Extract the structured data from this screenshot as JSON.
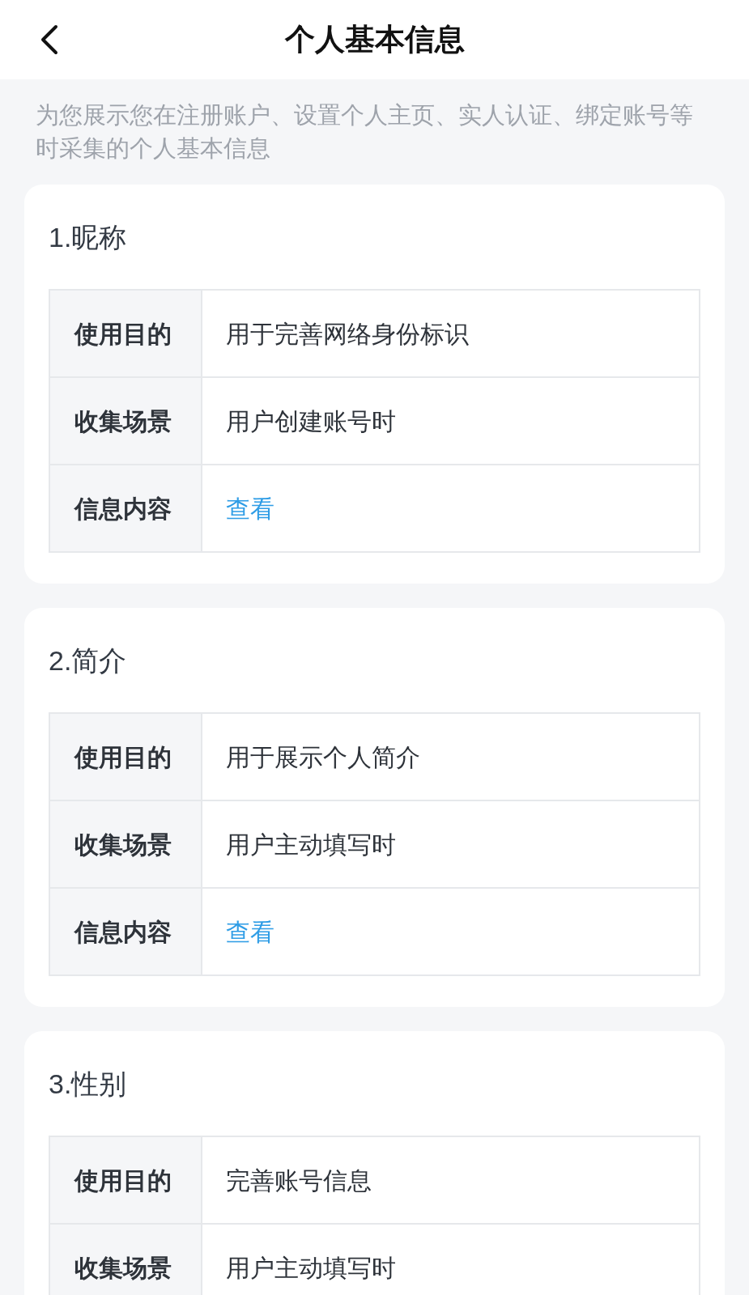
{
  "header": {
    "title": "个人基本信息"
  },
  "intro": "为您展示您在注册账户、设置个人主页、实人认证、绑定账号等时采集的个人基本信息",
  "sections": [
    {
      "title": "1.昵称",
      "rows": [
        {
          "label": "使用目的",
          "kind": "text",
          "value": "用于完善网络身份标识"
        },
        {
          "label": "收集场景",
          "kind": "text",
          "value": "用户创建账号时"
        },
        {
          "label": "信息内容",
          "kind": "link",
          "value": "查看"
        }
      ]
    },
    {
      "title": "2.简介",
      "rows": [
        {
          "label": "使用目的",
          "kind": "text",
          "value": "用于展示个人简介"
        },
        {
          "label": "收集场景",
          "kind": "text",
          "value": "用户主动填写时"
        },
        {
          "label": "信息内容",
          "kind": "link",
          "value": "查看"
        }
      ]
    },
    {
      "title": "3.性别",
      "rows": [
        {
          "label": "使用目的",
          "kind": "text",
          "value": "完善账号信息"
        },
        {
          "label": "收集场景",
          "kind": "text",
          "value": "用户主动填写时"
        }
      ]
    }
  ]
}
